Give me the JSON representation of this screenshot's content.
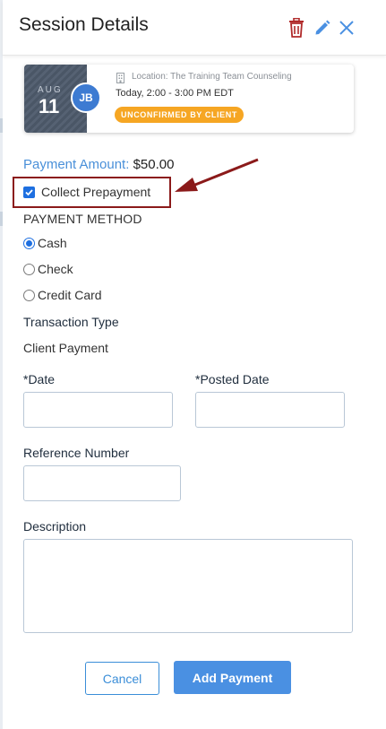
{
  "header": {
    "title": "Session Details",
    "icons": [
      "trash-icon",
      "pencil-icon",
      "close-icon"
    ]
  },
  "session_card": {
    "month": "AUG",
    "day": "11",
    "avatar_initials": "JB",
    "location": "Location: The Training Team Counseling",
    "time": "Today, 2:00 - 3:00 PM EDT",
    "status": "UNCONFIRMED BY CLIENT"
  },
  "payment": {
    "amount_label": "Payment Amount:",
    "amount_value": "$50.00",
    "collect_prepayment_label": "Collect Prepayment",
    "collect_prepayment_checked": true
  },
  "payment_method": {
    "heading": "PAYMENT METHOD",
    "options": [
      {
        "label": "Cash",
        "selected": true
      },
      {
        "label": "Check",
        "selected": false
      },
      {
        "label": "Credit Card",
        "selected": false
      }
    ]
  },
  "transaction": {
    "type_label": "Transaction Type",
    "type_value": "Client Payment"
  },
  "form": {
    "date_label": "*Date",
    "date_value": "",
    "posted_date_label": "*Posted Date",
    "posted_date_value": "",
    "reference_label": "Reference Number",
    "reference_value": "",
    "description_label": "Description",
    "description_value": ""
  },
  "actions": {
    "cancel_label": "Cancel",
    "add_label": "Add Payment"
  },
  "colors": {
    "accent_blue": "#4a90e2",
    "status_orange": "#f6a623",
    "delete_red": "#b02a2a",
    "highlight_dark_red": "#8b1a1a"
  }
}
